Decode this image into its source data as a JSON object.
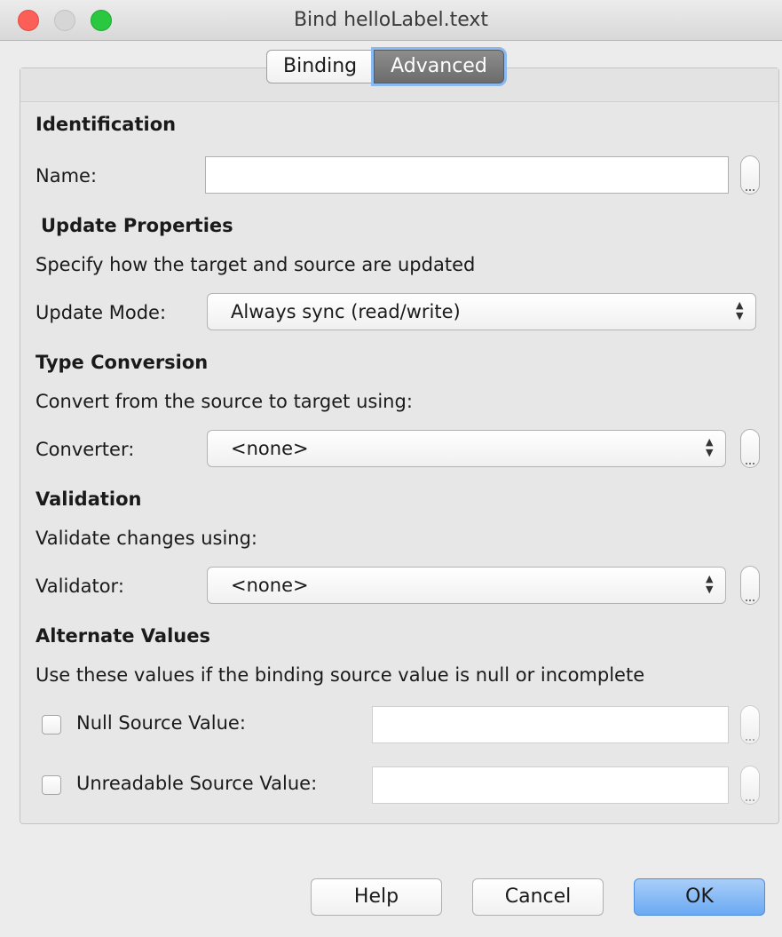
{
  "window": {
    "title": "Bind helloLabel.text"
  },
  "tabs": [
    {
      "label": "Binding",
      "active": false
    },
    {
      "label": "Advanced",
      "active": true
    }
  ],
  "identification": {
    "heading": "Identification",
    "name_label": "Name:",
    "name_value": ""
  },
  "update": {
    "heading": "Update Properties",
    "description": "Specify how the target and source are updated",
    "mode_label": "Update Mode:",
    "mode_value": "Always sync (read/write)"
  },
  "conversion": {
    "heading": "Type Conversion",
    "description": "Convert from the source to target using:",
    "converter_label": "Converter:",
    "converter_value": "<none>"
  },
  "validation": {
    "heading": "Validation",
    "description": "Validate changes using:",
    "validator_label": "Validator:",
    "validator_value": "<none>"
  },
  "alternate": {
    "heading": "Alternate Values",
    "description": "Use these values if the binding source value is null or incomplete",
    "null_label": "Null Source Value:",
    "null_checked": false,
    "null_value": "",
    "unreadable_label": "Unreadable Source Value:",
    "unreadable_checked": false,
    "unreadable_value": ""
  },
  "buttons": {
    "help": "Help",
    "cancel": "Cancel",
    "ok": "OK"
  },
  "colors": {
    "close": "#fc5f57",
    "maximize": "#2ac840",
    "active_tab": "#7a7a7a",
    "default_button": "#6aa9f2"
  }
}
